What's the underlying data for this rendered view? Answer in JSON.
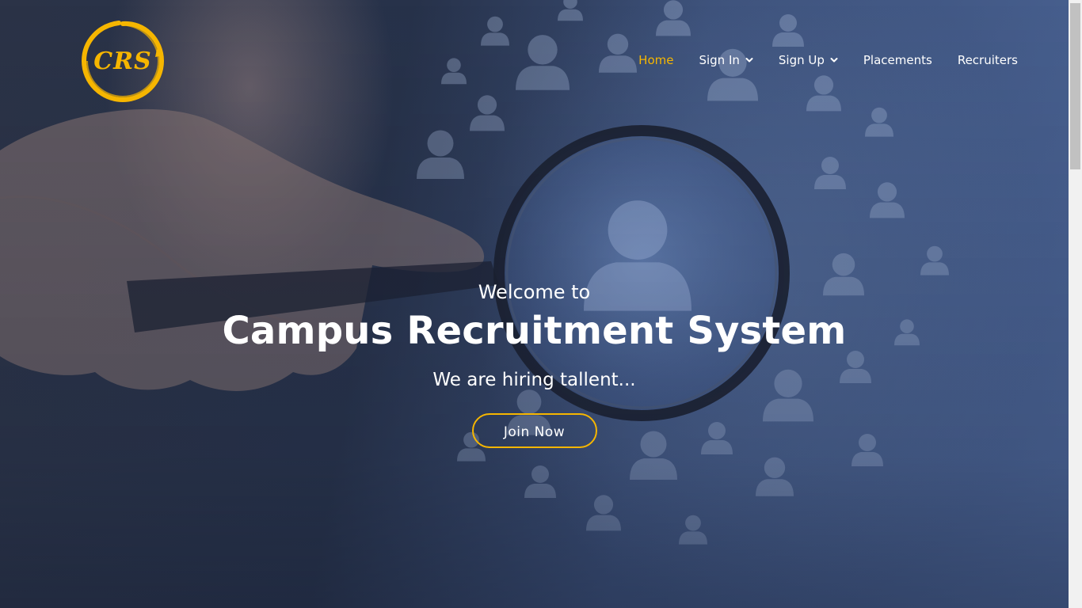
{
  "logo": {
    "text": "CRS",
    "accent_color": "#f6b600"
  },
  "nav": {
    "items": [
      {
        "label": "Home",
        "active": true
      },
      {
        "label": "Sign In",
        "dropdown": true,
        "icon": "chevron-down-icon"
      },
      {
        "label": "Sign Up",
        "dropdown": true,
        "icon": "chevron-down-icon"
      },
      {
        "label": "Placements"
      },
      {
        "label": "Recruiters"
      }
    ]
  },
  "hero": {
    "welcome": "Welcome to",
    "title": "Campus Recruitment System",
    "subtitle": "We are hiring tallent...",
    "cta_label": "Join Now"
  },
  "colors": {
    "accent": "#f6b600",
    "background": "#33466e",
    "text": "#ffffff"
  }
}
